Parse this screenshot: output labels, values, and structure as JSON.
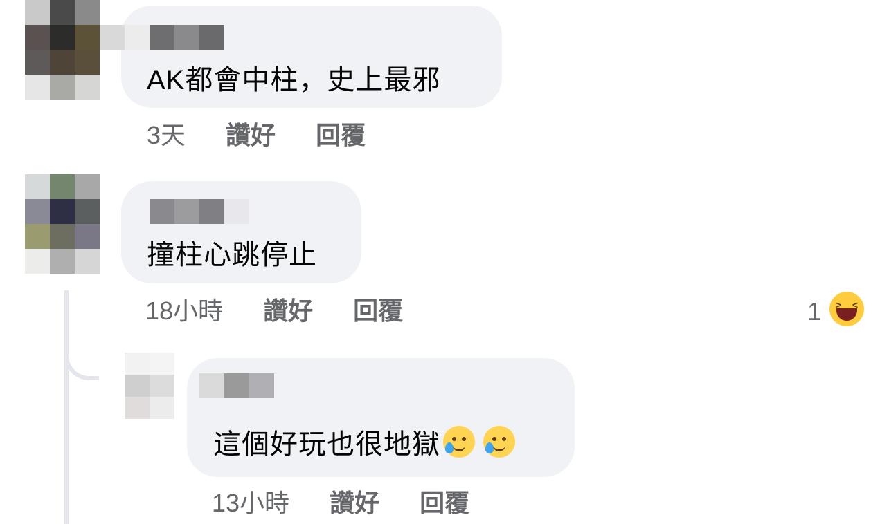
{
  "comments": [
    {
      "text": "AK都會中柱，史上最邪",
      "time": "3天",
      "like_label": "讚好",
      "reply_label": "回覆"
    },
    {
      "text": "撞柱心跳停止",
      "time": "18小時",
      "like_label": "讚好",
      "reply_label": "回覆",
      "reaction_count": "1",
      "reaction_icon": "laughing-emoji-icon"
    },
    {
      "text": "這個好玩也很地獄",
      "emojis": [
        "crying-smile-emoji-icon",
        "crying-smile-emoji-icon"
      ],
      "time": "13小時",
      "like_label": "讚好",
      "reply_label": "回覆"
    }
  ]
}
